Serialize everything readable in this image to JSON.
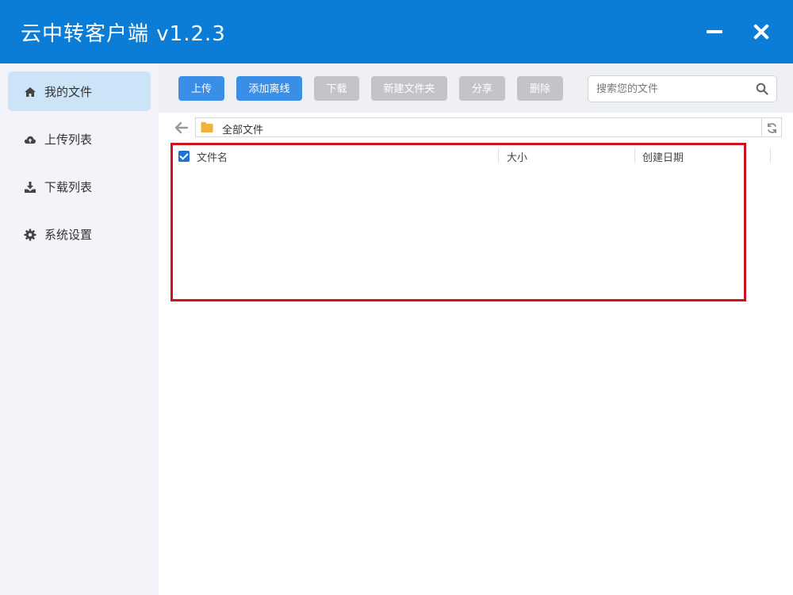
{
  "window": {
    "title": "云中转客户端  v1.2.3"
  },
  "sidebar": {
    "items": [
      {
        "label": "我的文件",
        "icon": "home-icon",
        "active": true
      },
      {
        "label": "上传列表",
        "icon": "cloud-upload-icon",
        "active": false
      },
      {
        "label": "下载列表",
        "icon": "download-icon",
        "active": false
      },
      {
        "label": "系统设置",
        "icon": "gear-icon",
        "active": false
      }
    ]
  },
  "toolbar": {
    "upload_label": "上传",
    "add_offline_label": "添加离线",
    "download_label": "下载",
    "new_folder_label": "新建文件夹",
    "share_label": "分享",
    "delete_label": "删除"
  },
  "search": {
    "placeholder": "搜索您的文件",
    "value": ""
  },
  "path": {
    "current": "全部文件"
  },
  "table": {
    "columns": [
      "文件名",
      "大小",
      "创建日期"
    ],
    "rows": []
  },
  "colors": {
    "titlebar": "#0b7dd7",
    "primary_button": "#3a8ee6",
    "disabled_button": "#c2c4c8",
    "highlight_border": "#d0101b",
    "sidebar_active": "#cde3f7",
    "folder": "#f0b23c"
  }
}
